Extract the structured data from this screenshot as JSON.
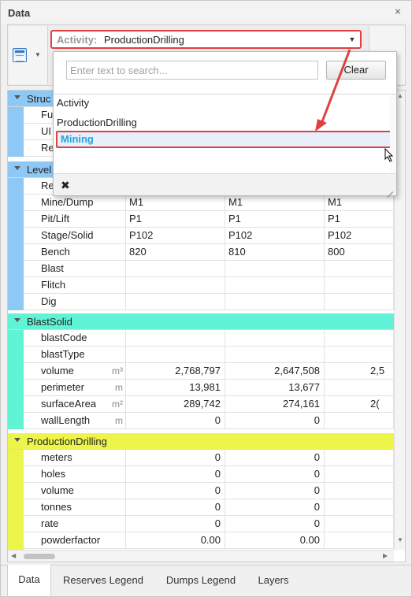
{
  "panel": {
    "title": "Data",
    "pin_icon": "pin-icon"
  },
  "toolbar": {
    "activity_label": "Activity:",
    "activity_value": "ProductionDrilling"
  },
  "dropdown": {
    "search_placeholder": "Enter text to search...",
    "clear_label": "Clear",
    "options": [
      "Activity",
      "ProductionDrilling",
      "Mining"
    ],
    "selected": "Mining",
    "close_icon": "close-icon"
  },
  "grid": {
    "categories": [
      {
        "name": "Struc",
        "color": "#8ec8f5"
      },
      {
        "name": "Level",
        "color": "#8ec8f5"
      },
      {
        "name": "BlastSolid",
        "color": "#60f3d5"
      },
      {
        "name": "ProductionDrilling",
        "color": "#edf54a"
      }
    ],
    "struc_rows": [
      "Fu",
      "UI",
      "Re"
    ],
    "level_rows": [
      {
        "name": "Re",
        "v": [
          "",
          "",
          ""
        ]
      },
      {
        "name": "Mine/Dump",
        "v": [
          "M1",
          "M1",
          "M1"
        ]
      },
      {
        "name": "Pit/Lift",
        "v": [
          "P1",
          "P1",
          "P1"
        ]
      },
      {
        "name": "Stage/Solid",
        "v": [
          "P102",
          "P102",
          "P102"
        ]
      },
      {
        "name": "Bench",
        "v": [
          "820",
          "810",
          "800"
        ]
      },
      {
        "name": "Blast",
        "v": [
          "",
          "",
          ""
        ]
      },
      {
        "name": "Flitch",
        "v": [
          "",
          "",
          ""
        ]
      },
      {
        "name": "Dig",
        "v": [
          "",
          "",
          ""
        ]
      }
    ],
    "blast_rows": [
      {
        "name": "blastCode",
        "unit": "",
        "v": [
          "",
          "",
          ""
        ]
      },
      {
        "name": "blastType",
        "unit": "",
        "v": [
          "",
          "",
          ""
        ]
      },
      {
        "name": "volume",
        "unit": "m³",
        "v": [
          "2,768,797",
          "2,647,508",
          "2,5"
        ]
      },
      {
        "name": "perimeter",
        "unit": "m",
        "v": [
          "13,981",
          "13,677",
          ""
        ]
      },
      {
        "name": "surfaceArea",
        "unit": "m²",
        "v": [
          "289,742",
          "274,161",
          "2("
        ]
      },
      {
        "name": "wallLength",
        "unit": "m",
        "v": [
          "0",
          "0",
          ""
        ]
      }
    ],
    "drill_rows": [
      {
        "name": "meters",
        "v": [
          "0",
          "0",
          ""
        ]
      },
      {
        "name": "holes",
        "v": [
          "0",
          "0",
          ""
        ]
      },
      {
        "name": "volume",
        "v": [
          "0",
          "0",
          ""
        ]
      },
      {
        "name": "tonnes",
        "v": [
          "0",
          "0",
          ""
        ]
      },
      {
        "name": "rate",
        "v": [
          "0",
          "0",
          ""
        ]
      },
      {
        "name": "powderfactor",
        "v": [
          "0.00",
          "0.00",
          ""
        ]
      }
    ]
  },
  "tabs": [
    "Data",
    "Reserves Legend",
    "Dumps Legend",
    "Layers"
  ],
  "active_tab": "Data",
  "annotation_color": "#e04040"
}
